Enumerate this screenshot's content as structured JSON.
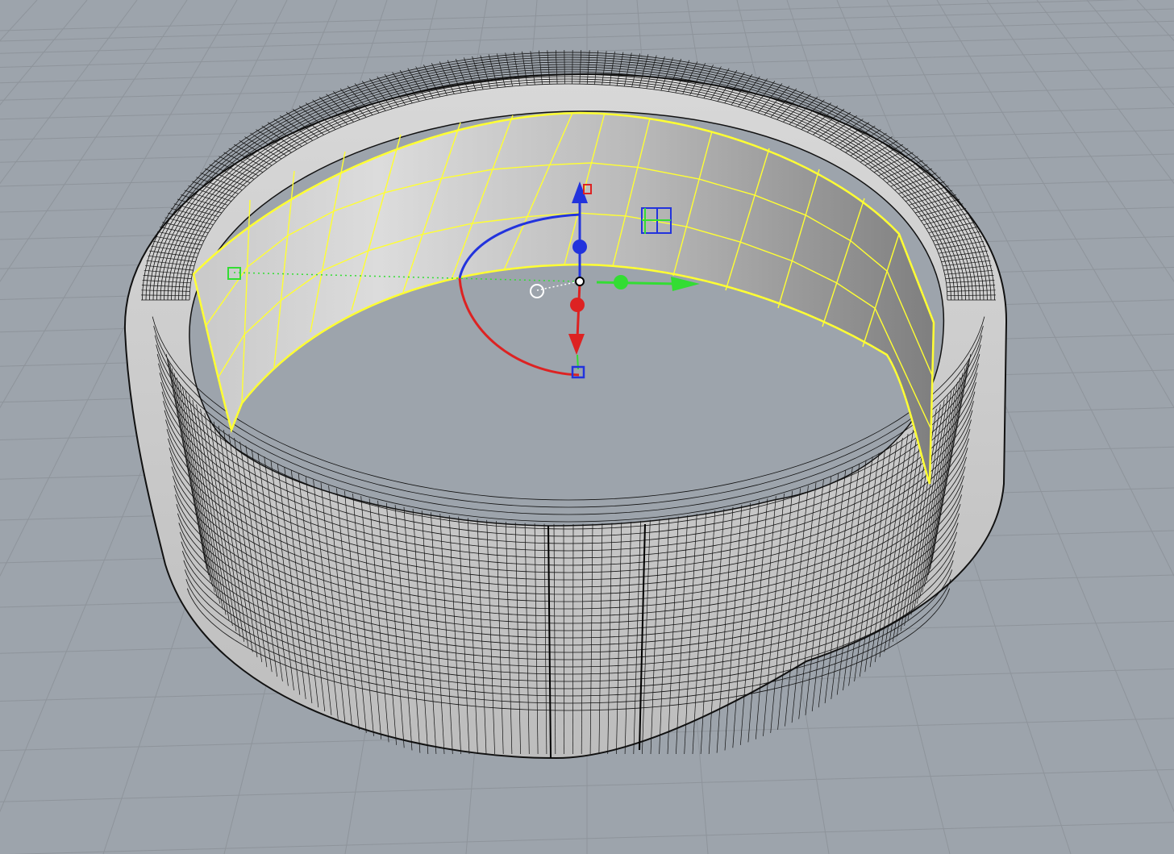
{
  "viewport": {
    "name": "Perspective",
    "background_color": "#9da4ac",
    "grid_color": "#8e949b"
  },
  "scene": {
    "ring_wire_color": "#111111",
    "ring_fill_color": "#e9e9e9",
    "selected_surface_color": "#ffff33",
    "selected_surface_fill": "#bdbdbd"
  },
  "gumball": {
    "x_axis_color": "#33dd33",
    "y_axis_color": "#dd2222",
    "z_axis_color": "#2233dd",
    "origin_color": "#ffffff"
  }
}
